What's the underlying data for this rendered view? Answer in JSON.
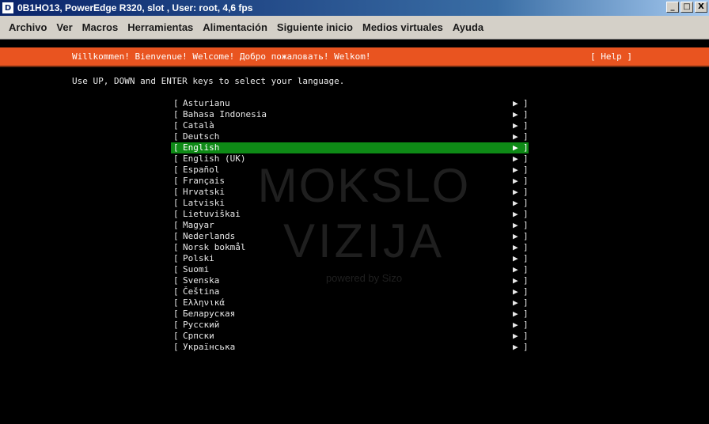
{
  "window": {
    "icon_letter": "D",
    "title": "0B1HO13, PowerEdge R320, slot , User: root, 4,6 fps",
    "buttons": {
      "minimize": "_",
      "maximize": "□",
      "close": "X"
    }
  },
  "menu": [
    "Archivo",
    "Ver",
    "Macros",
    "Herramientas",
    "Alimentación",
    "Siguiente inicio",
    "Medios virtuales",
    "Ayuda"
  ],
  "installer": {
    "welcome": "Willkommen! Bienvenue! Welcome! Добро пожаловать! Welkom!",
    "help": "[ Help ]",
    "instruction": "Use UP, DOWN and ENTER keys to select your language.",
    "bracket_left": "[",
    "bracket_right": "]",
    "arrow": "▶",
    "selected_index": 4,
    "colors": {
      "header": "#e95420",
      "selection": "#0e8a16"
    },
    "languages": [
      "Asturianu",
      "Bahasa Indonesia",
      "Català",
      "Deutsch",
      "English",
      "English (UK)",
      "Español",
      "Français",
      "Hrvatski",
      "Latviski",
      "Lietuviškai",
      "Magyar",
      "Nederlands",
      "Norsk bokmål",
      "Polski",
      "Suomi",
      "Svenska",
      "Čeština",
      "Ελληνικά",
      "Беларуская",
      "Русский",
      "Српски",
      "Українська"
    ]
  },
  "watermark": {
    "line1": "MOKSLO",
    "line2": "VIZIJA",
    "line3": "powered by Sizo"
  }
}
